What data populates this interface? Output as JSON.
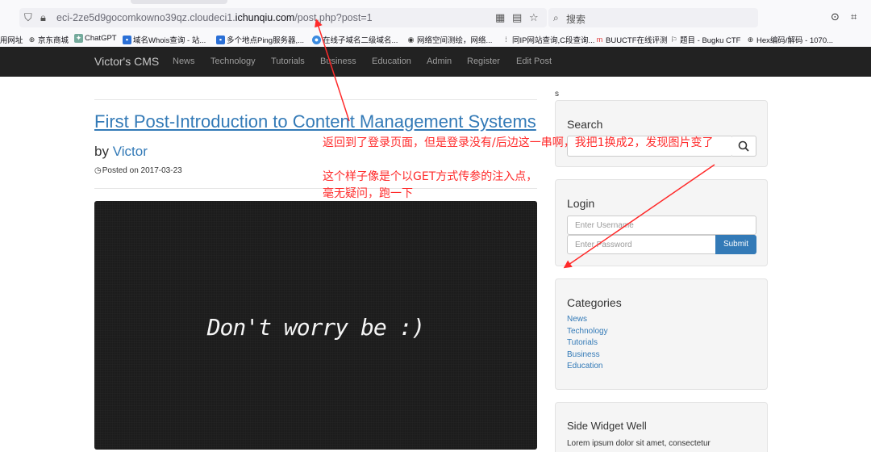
{
  "browser": {
    "url_prefix": "eci-2ze5d9gocomkowno39qz.cloudeci1.",
    "url_domain": "ichunqiu.com",
    "url_suffix": "/post.php?post=1",
    "search_placeholder": "搜索"
  },
  "bookmarks": [
    {
      "label": "用网址",
      "icon": "none"
    },
    {
      "label": "京东商城",
      "icon": "globe-icon"
    },
    {
      "label": "ChatGPT",
      "icon": "chatgpt-icon"
    },
    {
      "label": "域名Whois查询 - 站...",
      "icon": "bookmark-icon"
    },
    {
      "label": "多个地点Ping服务器,...",
      "icon": "bookmark-icon"
    },
    {
      "label": "在线子域名二级域名...",
      "icon": "bookmark-icon"
    },
    {
      "label": "网络空间测绘，网络...",
      "icon": "bookmark-icon"
    },
    {
      "label": "同IP网站查询,C段查询...",
      "icon": "bookmark-icon"
    },
    {
      "label": "BUUCTF在线评测",
      "icon": "bookmark-icon"
    },
    {
      "label": "题目 - Bugku CTF",
      "icon": "bookmark-icon"
    },
    {
      "label": "Hex编码/解码 - 1070...",
      "icon": "globe-icon"
    }
  ],
  "navbar": {
    "brand": "Victor's CMS",
    "items": [
      "News",
      "Technology",
      "Tutorials",
      "Business",
      "Education",
      "Admin",
      "Register",
      "Edit Post"
    ]
  },
  "stray_text": "s",
  "post": {
    "title": "First Post-Introduction to Content Management Systems",
    "by": "by",
    "author": "Victor",
    "posted": "Posted on 2017-03-23",
    "image_text": "Don't worry be :)"
  },
  "sidebar": {
    "search_title": "Search",
    "login_title": "Login",
    "username_placeholder": "Enter Username",
    "password_placeholder": "Enter Password",
    "submit_label": "Submit",
    "categories_title": "Categories",
    "categories": [
      "News",
      "Technology",
      "Tutorials",
      "Business",
      "Education"
    ],
    "widget_title": "Side Widget Well",
    "widget_text": "Lorem ipsum dolor sit amet, consectetur"
  },
  "annotations": {
    "line1": "返回到了登录页面，但是登录没有/后边这一串啊，我把1换成2，发现图片变了",
    "line2": "这个样子像是个以GET方式传参的注入点，",
    "line3": "毫无疑问，跑一下"
  },
  "colors": {
    "navbar_bg": "#222222",
    "link": "#337ab7",
    "annotation": "#ff2a2a",
    "well_bg": "#f5f5f5"
  }
}
